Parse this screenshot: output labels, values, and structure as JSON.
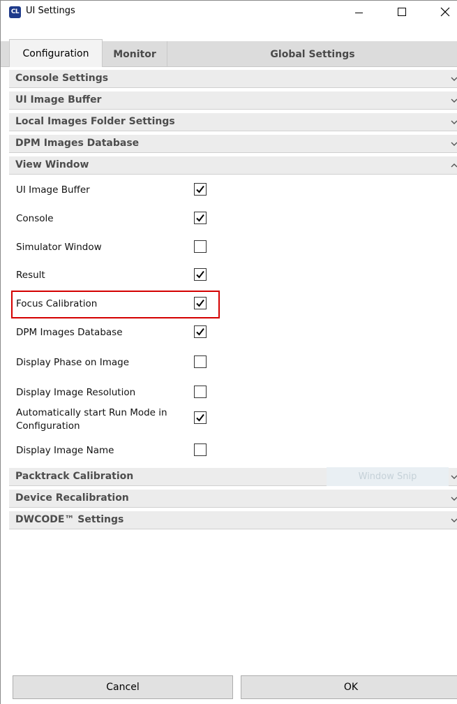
{
  "window": {
    "title": "UI Settings",
    "icon_label": "CL"
  },
  "tabs": [
    {
      "label": "Configuration",
      "selected": true
    },
    {
      "label": "Monitor",
      "selected": false
    },
    {
      "label": "Global Settings",
      "selected": false
    }
  ],
  "sections_top": [
    {
      "label": "Console Settings",
      "expanded": false
    },
    {
      "label": "UI Image Buffer",
      "expanded": false
    },
    {
      "label": "Local Images Folder Settings",
      "expanded": false
    },
    {
      "label": "DPM Images Database",
      "expanded": false
    },
    {
      "label": "View Window",
      "expanded": true
    }
  ],
  "view_window_items": [
    {
      "label": "UI Image Buffer",
      "checked": true
    },
    {
      "label": "Console",
      "checked": true
    },
    {
      "label": "Simulator Window",
      "checked": false
    },
    {
      "label": "Result",
      "checked": true
    },
    {
      "label": "Focus Calibration",
      "checked": true,
      "highlighted": true
    },
    {
      "label": "DPM Images Database",
      "checked": true
    },
    {
      "label": "Display Phase on Image",
      "checked": false
    },
    {
      "label": "Display Image Resolution",
      "checked": false
    },
    {
      "label": "Automatically start Run Mode in Configuration",
      "checked": true
    },
    {
      "label": "Display Image Name",
      "checked": false
    }
  ],
  "sections_bottom": [
    {
      "label": "Packtrack Calibration",
      "expanded": false
    },
    {
      "label": "Device Recalibration",
      "expanded": false
    },
    {
      "label": "DWCODE™ Settings",
      "expanded": false
    }
  ],
  "overlay": {
    "window_snip_label": "Window Snip"
  },
  "buttons": {
    "cancel": "Cancel",
    "ok": "OK"
  },
  "colors": {
    "highlight": "#d40000",
    "section_bg": "#ececec",
    "tab_bar": "#dcdcdc",
    "button_bg": "#e1e1e1"
  },
  "icons": {
    "window_minimize": "minimize-icon",
    "window_maximize": "maximize-icon",
    "window_close": "close-icon",
    "collapsed": "chevron-down-icon",
    "expanded": "chevron-up-icon",
    "checked": "checkmark-icon"
  }
}
